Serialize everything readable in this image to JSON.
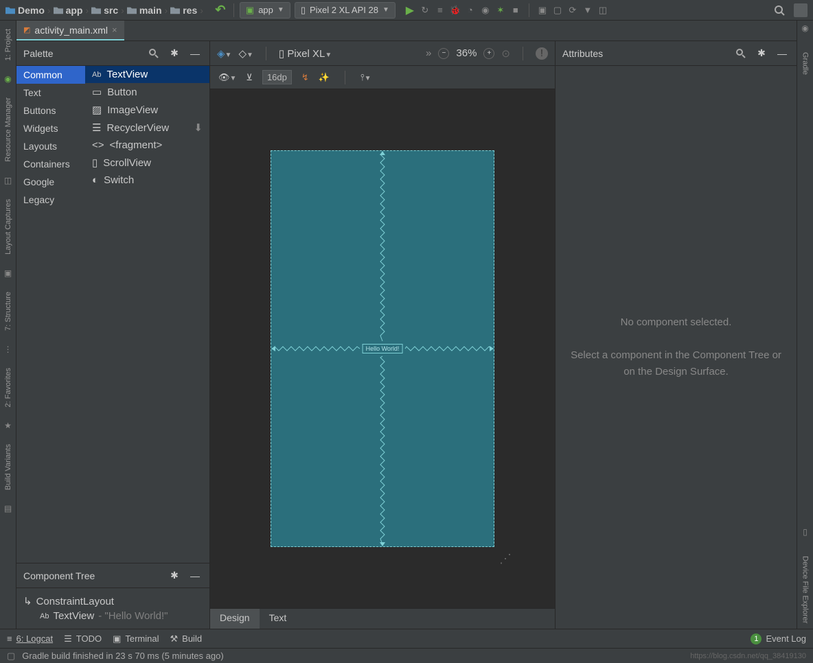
{
  "breadcrumb": [
    "Demo",
    "app",
    "src",
    "main",
    "res"
  ],
  "app_config": "app",
  "device_config": "Pixel 2 XL API 28",
  "file_tab": "activity_main.xml",
  "palette": {
    "title": "Palette",
    "categories": [
      "Common",
      "Text",
      "Buttons",
      "Widgets",
      "Layouts",
      "Containers",
      "Google",
      "Legacy"
    ],
    "items": [
      "TextView",
      "Button",
      "ImageView",
      "RecyclerView",
      "<fragment>",
      "ScrollView",
      "Switch"
    ]
  },
  "component_tree": {
    "title": "Component Tree",
    "root": "ConstraintLayout",
    "child": "TextView",
    "child_hint": "- \"Hello World!\""
  },
  "design_toolbar": {
    "device": "Pixel XL",
    "zoom": "36%",
    "dp": "16dp"
  },
  "canvas_widget_text": "Hello World!",
  "attributes": {
    "title": "Attributes",
    "empty1": "No component selected.",
    "empty2": "Select a component in the Component Tree or on the Design Surface."
  },
  "bottom_tabs": {
    "design": "Design",
    "text": "Text"
  },
  "statusbar": {
    "logcat": "6: Logcat",
    "todo": "TODO",
    "terminal": "Terminal",
    "build": "Build",
    "event_log": "Event Log",
    "event_count": "1"
  },
  "build_msg": "Gradle build finished in 23 s 70 ms (5 minutes ago)",
  "watermark": "https://blog.csdn.net/qq_38419130",
  "left_rail": {
    "project": "1: Project",
    "resource": "Resource Manager",
    "captures": "Layout Captures",
    "structure": "7: Structure",
    "favorites": "2: Favorites",
    "variants": "Build Variants"
  },
  "right_rail": {
    "gradle": "Gradle",
    "device_explorer": "Device File Explorer"
  }
}
